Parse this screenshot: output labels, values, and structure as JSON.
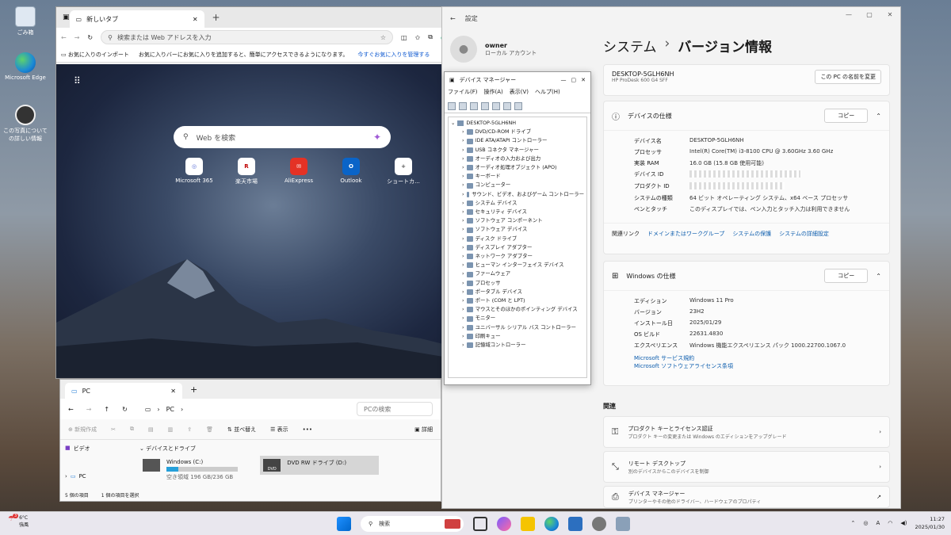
{
  "desktop": {
    "icons": [
      {
        "label": "ごみ箱",
        "icon": "recycle-bin-icon"
      },
      {
        "label": "Microsoft Edge",
        "icon": "edge-icon"
      },
      {
        "label": "この写真についての詳しい情報",
        "icon": "info-icon"
      }
    ]
  },
  "browser": {
    "tab_title": "新しいタブ",
    "address_placeholder": "検索または Web アドレスを入力",
    "favbar": {
      "import": "お気に入りのインポート",
      "hint": "お気に入りバーにお気に入りを追加すると、簡単にアクセスできるようになります。",
      "manage": "今すぐお気に入りを管理する"
    },
    "search_placeholder": "Web を検索",
    "quicklinks": [
      {
        "label": "Microsoft 365",
        "glyph": "◎",
        "color": "#5b6fd6"
      },
      {
        "label": "楽天市場",
        "glyph": "R",
        "color": "#bf0000"
      },
      {
        "label": "AliExpress",
        "glyph": "✉",
        "color": "#e43225"
      },
      {
        "label": "Outlook",
        "glyph": "O",
        "color": "#0a64c8"
      },
      {
        "label": "ショートカ...",
        "glyph": "+",
        "color": "#555555"
      }
    ]
  },
  "explorer": {
    "tab_title": "PC",
    "path": "PC",
    "search_placeholder": "PCの検索",
    "cmd": {
      "new": "新規作成",
      "sort": "並べ替え",
      "view": "表示",
      "more": "•••",
      "details": "詳細"
    },
    "sidebar": [
      {
        "label": "ビデオ"
      },
      {
        "label": "PC"
      }
    ],
    "group_header": "デバイスとドライブ",
    "drives": [
      {
        "name": "Windows (C:)",
        "free": "空き領域 196 GB/236 GB",
        "used_fraction": 0.17
      },
      {
        "name": "DVD RW ドライブ (D:)",
        "badge": "DVD"
      }
    ],
    "status": {
      "count": "5 個の項目",
      "selected": "1 個の項目を選択"
    }
  },
  "settings": {
    "title": "設定",
    "user": {
      "name": "owner",
      "account": "ローカル アカウント"
    },
    "breadcrumb": {
      "root": "システム",
      "sep": "›",
      "page": "バージョン情報"
    },
    "device": {
      "name": "DESKTOP-5GLH6NH",
      "model": "HP ProDesk 600 G4 SFF",
      "rename": "この PC の名前を変更"
    },
    "device_spec": {
      "title": "デバイスの仕様",
      "copy": "コピー",
      "rows": [
        {
          "k": "デバイス名",
          "v": "DESKTOP-5GLH6NH"
        },
        {
          "k": "プロセッサ",
          "v": "Intel(R) Core(TM) i3-8100 CPU @ 3.60GHz   3.60 GHz"
        },
        {
          "k": "実装 RAM",
          "v": "16.0 GB (15.8 GB 使用可能)"
        },
        {
          "k": "デバイス ID",
          "v": ""
        },
        {
          "k": "プロダクト ID",
          "v": ""
        },
        {
          "k": "システムの種類",
          "v": "64 ビット オペレーティング システム、x64 ベース プロセッサ"
        },
        {
          "k": "ペンとタッチ",
          "v": "このディスプレイでは、ペン入力とタッチ入力は利用できません"
        }
      ],
      "related_label": "関連リンク",
      "related_links": [
        "ドメインまたはワークグループ",
        "システムの保護",
        "システムの詳細設定"
      ]
    },
    "windows_spec": {
      "title": "Windows の仕様",
      "copy": "コピー",
      "rows": [
        {
          "k": "エディション",
          "v": "Windows 11 Pro"
        },
        {
          "k": "バージョン",
          "v": "23H2"
        },
        {
          "k": "インストール日",
          "v": "2025/01/29"
        },
        {
          "k": "OS ビルド",
          "v": "22631.4830"
        },
        {
          "k": "エクスペリエンス",
          "v": "Windows 機能エクスペリエンス パック 1000.22700.1067.0"
        }
      ],
      "links": [
        "Microsoft サービス規約",
        "Microsoft ソフトウェアライセンス条項"
      ]
    },
    "related": {
      "title": "関連",
      "items": [
        {
          "title": "プロダクト キーとライセンス認証",
          "sub": "プロダクト キーの変更または Windows のエディションをアップグレード",
          "icon": "key-icon"
        },
        {
          "title": "リモート デスクトップ",
          "sub": "別のデバイスからこのデバイスを制御",
          "icon": "remote-icon"
        },
        {
          "title": "デバイス マネージャー",
          "sub": "プリンターやその他のドライバー、ハードウェアのプロパティ",
          "icon": "printer-icon"
        }
      ]
    }
  },
  "devmgr": {
    "title": "デバイス マネージャー",
    "menu": [
      "ファイル(F)",
      "操作(A)",
      "表示(V)",
      "ヘルプ(H)"
    ],
    "root": "DESKTOP-5GLH6NH",
    "items": [
      "DVD/CD-ROM ドライブ",
      "IDE ATA/ATAPI コントローラー",
      "USB コネクタ マネージャー",
      "オーディオの入力および出力",
      "オーディオ処理オブジェクト (APO)",
      "キーボード",
      "コンピューター",
      "サウンド、ビデオ、およびゲーム コントローラー",
      "システム デバイス",
      "セキュリティ デバイス",
      "ソフトウェア コンポーネント",
      "ソフトウェア デバイス",
      "ディスク ドライブ",
      "ディスプレイ アダプター",
      "ネットワーク アダプター",
      "ヒューマン インターフェイス デバイス",
      "ファームウェア",
      "プロセッサ",
      "ポータブル デバイス",
      "ポート (COM と LPT)",
      "マウスとそのほかのポインティング デバイス",
      "モニター",
      "ユニバーサル シリアル バス コントローラー",
      "印刷キュー",
      "記憶域コントローラー"
    ]
  },
  "taskbar": {
    "weather": {
      "temp": "6°C",
      "desc": "強風",
      "badge": "3"
    },
    "search": "検索",
    "time": "11:27",
    "date": "2025/01/30",
    "ime": "A"
  }
}
